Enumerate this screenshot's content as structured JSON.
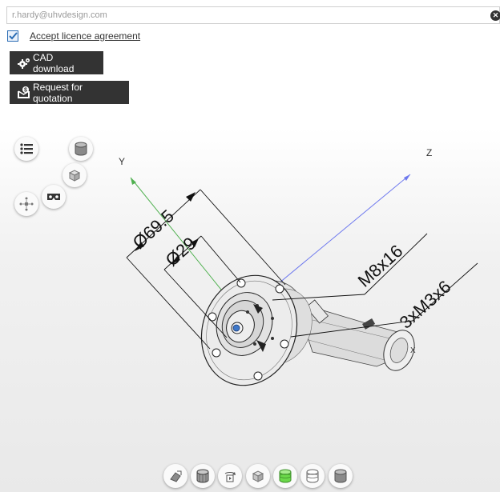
{
  "form": {
    "email_value": "r.hardy@uhvdesign.com",
    "licence_label": "Accept licence agreement",
    "licence_checked": true
  },
  "buttons": {
    "cad_download": "CAD download",
    "request_quote": "Request for quotation"
  },
  "viewer": {
    "axes": {
      "y": "Y",
      "z": "Z",
      "x": "X"
    },
    "dimensions": {
      "outer_diameter": "Ø69.5",
      "inner_diameter": "Ø29",
      "thread": "M8x16",
      "holes": "3xM3x6"
    },
    "left_tools": [
      "list-icon",
      "cylinder-view-icon",
      "cube-view-icon",
      "vr-goggles-icon",
      "explode-icon"
    ],
    "bottom_tools": [
      "measure-icon",
      "wireframe-icon",
      "rotate-play-icon",
      "cube-icon",
      "section-active-icon",
      "section-icon",
      "shaded-icon"
    ],
    "accent_green": "#6bd84a"
  }
}
